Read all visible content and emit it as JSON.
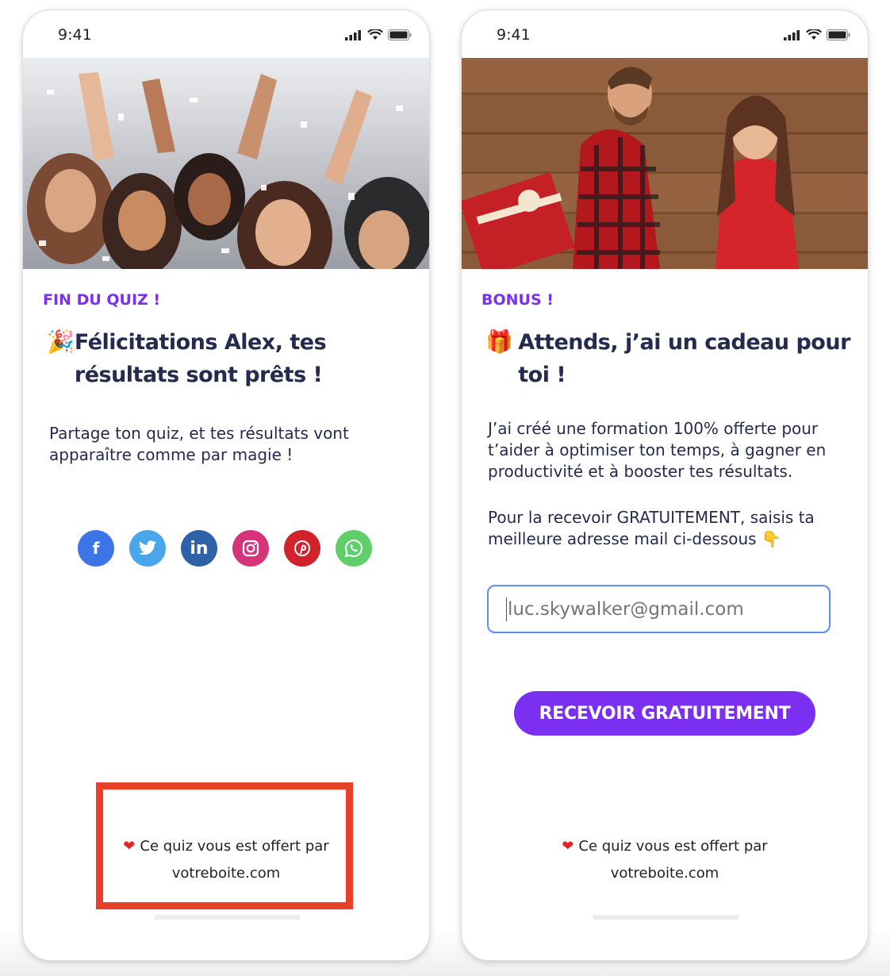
{
  "colors": {
    "accent": "#7b2ff0",
    "heading": "#252a4f",
    "highlight": "#e8402b",
    "input_border": "#5a8ff5"
  },
  "left_screen": {
    "status_time": "9:41",
    "eyebrow": "FIN DU QUIZ !",
    "title_emoji": "🎉",
    "title": "Félicitations Alex, tes résultats sont prêts !",
    "body": "Partage ton quiz, et tes résultats vont apparaître comme par magie !",
    "socials": [
      {
        "name": "facebook-icon",
        "glyph": "f",
        "color": "#3b75e8"
      },
      {
        "name": "twitter-icon",
        "glyph": "🐦",
        "color": "#4aa6ea"
      },
      {
        "name": "linkedin-icon",
        "glyph": "in",
        "color": "#2e62a8"
      },
      {
        "name": "instagram-icon",
        "glyph": "◎",
        "color": "#d6347a"
      },
      {
        "name": "pinterest-icon",
        "glyph": "p",
        "color": "#d2232c"
      },
      {
        "name": "whatsapp-icon",
        "glyph": "✆",
        "color": "#5fcf6a"
      }
    ],
    "footer_line1": "Ce quiz vous est offert par",
    "footer_line2": "votreboite.com",
    "footer_heart": "❤"
  },
  "right_screen": {
    "status_time": "9:41",
    "eyebrow": "BONUS !",
    "title_emoji": "🎁",
    "title": "Attends, j’ai un cadeau pour toi !",
    "body1": "J’ai créé une formation 100% offerte pour t’aider à optimiser ton temps, à gagner en productivité et à booster tes résultats.",
    "body2": "Pour la recevoir GRATUITEMENT, saisis ta meilleure adresse mail ci-dessous 👇",
    "email_placeholder": "luc.skywalker@gmail.com",
    "cta_label": "RECEVOIR GRATUITEMENT",
    "footer_line1": "Ce quiz vous est offert par",
    "footer_line2": "votreboite.com",
    "footer_heart": "❤"
  }
}
